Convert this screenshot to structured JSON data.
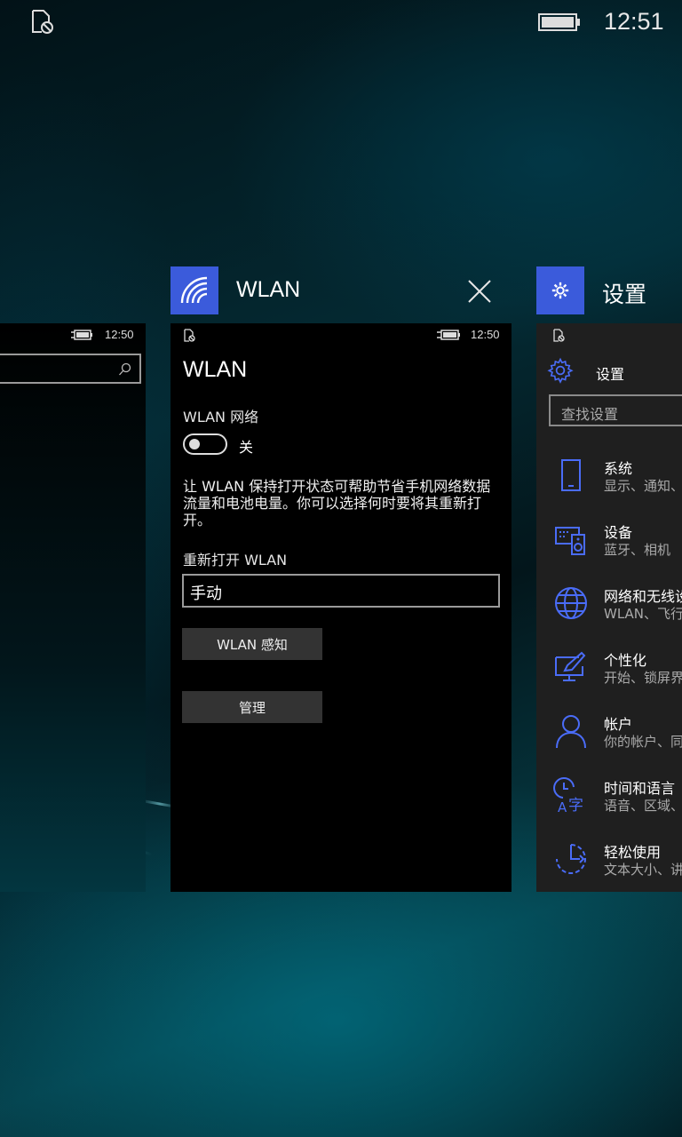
{
  "status_bar": {
    "time": "12:51"
  },
  "mini_status": {
    "time_left": "12:50",
    "time_mid": "12:50"
  },
  "app_headers": {
    "wlan": {
      "title": "WLAN",
      "accent": "#3b5bdb"
    },
    "settings": {
      "title": "设置",
      "accent": "#3b5bdb"
    }
  },
  "wlan_page": {
    "title": "WLAN",
    "network_label": "WLAN 网络",
    "toggle_state": "关",
    "description": "让 WLAN 保持打开状态可帮助节省手机网络数据流量和电池电量。你可以选择何时要将其重新打开。",
    "reopen_label": "重新打开 WLAN",
    "reopen_value": "手动",
    "sense_button": "WLAN 感知",
    "manage_button": "管理"
  },
  "settings_page": {
    "title": "设置",
    "search_placeholder": "查找设置",
    "items": [
      {
        "title": "系统",
        "subtitle": "显示、通知、",
        "icon": "phone-icon"
      },
      {
        "title": "设备",
        "subtitle": "蓝牙、相机",
        "icon": "devices-icon"
      },
      {
        "title": "网络和无线设",
        "subtitle": "WLAN、飞行",
        "icon": "globe-icon"
      },
      {
        "title": "个性化",
        "subtitle": "开始、锁屏界",
        "icon": "personalization-icon"
      },
      {
        "title": "帐户",
        "subtitle": "你的帐户、同",
        "icon": "person-icon"
      },
      {
        "title": "时间和语言",
        "subtitle": "语音、区域、",
        "icon": "time-language-icon"
      },
      {
        "title": "轻松使用",
        "subtitle": "文本大小、讲",
        "icon": "ease-of-access-icon"
      }
    ]
  },
  "colors": {
    "accent": "#3b5bdb",
    "settings_icon": "#4a6cf7"
  }
}
